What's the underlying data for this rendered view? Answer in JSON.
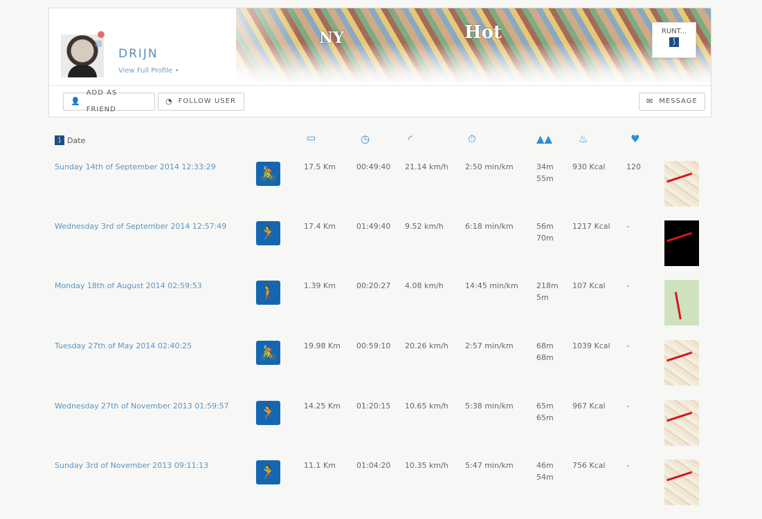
{
  "profile": {
    "username": "DRIJN",
    "view_profile": "View Full Profile •",
    "app_badge": "RUNT..."
  },
  "actions": {
    "add_friend": "ADD AS FRIEND",
    "follow_user": "FOLLOW USER",
    "message": "MESSAGE"
  },
  "table": {
    "date_header": "Date",
    "header_icons": [
      "distance-ruler-icon",
      "duration-clock-icon",
      "speed-gauge-icon",
      "pace-icon",
      "elevation-mountains-icon",
      "calories-flame-icon",
      "heart-rate-icon"
    ]
  },
  "activities": [
    {
      "date": "Sunday 14th of September 2014 12:33:29",
      "sport": "cycling",
      "distance": "17.5 Km",
      "duration": "00:49:40",
      "speed": "21.14 km/h",
      "pace": "2:50 min/km",
      "elev_up": "34m",
      "elev_down": "55m",
      "calories": "930 Kcal",
      "heart_rate": "120",
      "map": "light"
    },
    {
      "date": "Wednesday 3rd of September 2014 12:57:49",
      "sport": "running",
      "distance": "17.4 Km",
      "duration": "01:49:40",
      "speed": "9.52 km/h",
      "pace": "6:18 min/km",
      "elev_up": "56m",
      "elev_down": "70m",
      "calories": "1217 Kcal",
      "heart_rate": "-",
      "map": "dark"
    },
    {
      "date": "Monday 18th of August 2014 02:59:53",
      "sport": "hiking",
      "distance": "1.39 Km",
      "duration": "00:20:27",
      "speed": "4.08 km/h",
      "pace": "14:45 min/km",
      "elev_up": "218m",
      "elev_down": "5m",
      "calories": "107 Kcal",
      "heart_rate": "-",
      "map": "green"
    },
    {
      "date": "Tuesday 27th of May 2014 02:40:25",
      "sport": "cycling",
      "distance": "19.98 Km",
      "duration": "00:59:10",
      "speed": "20.26 km/h",
      "pace": "2:57 min/km",
      "elev_up": "68m",
      "elev_down": "68m",
      "calories": "1039 Kcal",
      "heart_rate": "-",
      "map": "light"
    },
    {
      "date": "Wednesday 27th of November 2013 01:59:57",
      "sport": "running",
      "distance": "14.25 Km",
      "duration": "01:20:15",
      "speed": "10.65 km/h",
      "pace": "5:38 min/km",
      "elev_up": "65m",
      "elev_down": "65m",
      "calories": "967 Kcal",
      "heart_rate": "-",
      "map": "light"
    },
    {
      "date": "Sunday 3rd of November 2013 09:11:13",
      "sport": "running",
      "distance": "11.1 Km",
      "duration": "01:04:20",
      "speed": "10.35 km/h",
      "pace": "5:47 min/km",
      "elev_up": "46m",
      "elev_down": "54m",
      "calories": "756 Kcal",
      "heart_rate": "-",
      "map": "light"
    }
  ],
  "colors": {
    "accent": "#2d8ed3",
    "link": "#5b94c1",
    "sport_icon_bg": "#1566b0",
    "route": "#d6141d"
  }
}
